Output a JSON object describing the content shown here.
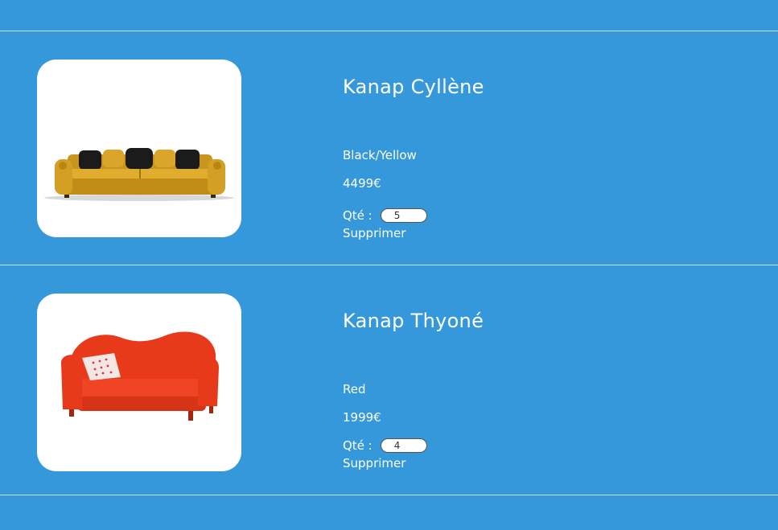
{
  "colors": {
    "background": "#3498db",
    "text": "#ffffff",
    "card": "#ffffff"
  },
  "cart": {
    "items": [
      {
        "name": "Kanap Cyllène",
        "color": "Black/Yellow",
        "price": "4499€",
        "qty_label": "Qté :",
        "quantity": "5",
        "delete_label": "Supprimer",
        "image_icon": "sofa-yellow-black-image"
      },
      {
        "name": "Kanap Thyoné",
        "color": "Red",
        "price": "1999€",
        "qty_label": "Qté :",
        "quantity": "4",
        "delete_label": "Supprimer",
        "image_icon": "sofa-red-image"
      }
    ]
  }
}
